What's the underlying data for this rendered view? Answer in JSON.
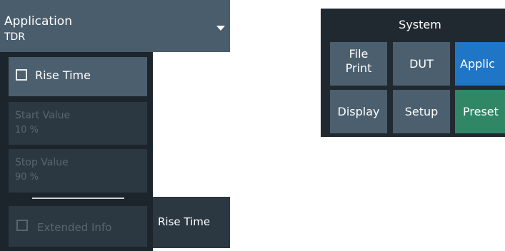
{
  "application": {
    "title": "Application",
    "value": "TDR",
    "dropdown_icon": "triangle-down"
  },
  "panel": {
    "rise_time": {
      "label": "Rise Time",
      "checked": false
    },
    "start_value": {
      "label": "Start Value",
      "value": "10 %",
      "enabled": false
    },
    "stop_value": {
      "label": "Stop Value",
      "value": "90 %",
      "enabled": false
    },
    "extended_info": {
      "label": "Extended Info",
      "checked": false,
      "enabled": false
    },
    "tab_label": "Rise Time"
  },
  "system": {
    "title": "System",
    "buttons": {
      "file_print": [
        "File",
        "Print"
      ],
      "dut": "DUT",
      "applic": "Applic",
      "display": "Display",
      "setup": "Setup",
      "preset": "Preset"
    },
    "colors": {
      "active": "#1f75c6",
      "preset": "#2f8766",
      "default": "#4b5f6e"
    }
  }
}
